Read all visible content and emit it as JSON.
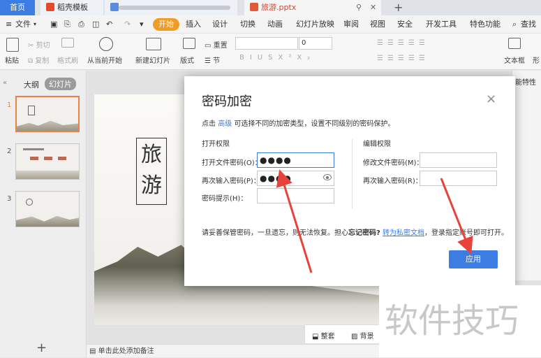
{
  "tabs": {
    "home": "首页",
    "template": "稻壳模板",
    "doc": "旅游.pptx",
    "new_tab": "+"
  },
  "menu": {
    "file": "文件",
    "items": [
      "开始",
      "插入",
      "设计",
      "切换",
      "动画",
      "幻灯片放映",
      "审阅",
      "视图",
      "安全",
      "开发工具",
      "特色功能"
    ],
    "search": "查找"
  },
  "ribbon": {
    "paste": "粘贴",
    "cut": "剪切",
    "copy": "复制",
    "format_painter": "格式刷",
    "play_from_current": "从当前开始",
    "new_slide": "新建幻灯片",
    "layout": "版式",
    "reset": "重置",
    "section": "节",
    "font_size": "0",
    "textbox": "文本框",
    "shape": "形"
  },
  "left_panel": {
    "tab_outline": "大纲",
    "tab_slides": "幻灯片",
    "slide_numbers": [
      "1",
      "2",
      "3"
    ],
    "add_slide": "+"
  },
  "slide": {
    "title_chars": [
      "旅",
      "游"
    ]
  },
  "right_panel": {
    "label": "能特性"
  },
  "dialog": {
    "title": "密码加密",
    "close": "×",
    "desc_prefix": "点击",
    "desc_link": "高级",
    "desc_suffix": "可选择不同的加密类型，设置不同级别的密码保护。",
    "open_section": "打开权限",
    "open_password_label": "打开文件密码(O)：",
    "open_password_value": "●●●●",
    "confirm_password_label": "再次输入密码(P)：",
    "confirm_password_value": "●●●●",
    "hint_label": "密码提示(H)：",
    "hint_value": "",
    "edit_section": "编辑权限",
    "edit_password_label": "修改文件密码(M)：",
    "edit_password_value": "",
    "edit_confirm_label": "再次输入密码(R)：",
    "edit_confirm_value": "",
    "warning_prefix": "请妥善保管密码，一旦遗忘，则无法恢复。担心",
    "warning_bold": "忘记密码?",
    "warning_link": "转为私密文档",
    "warning_suffix": "，登录指定账号即可打开。",
    "apply_button": "应用"
  },
  "bottom": {
    "tidy": "整套",
    "background": "背景",
    "notes_placeholder": "单击此处添加备注"
  },
  "watermark": "软件技巧",
  "colors": {
    "accent_blue": "#3c7de4",
    "active_orange": "#f29b26",
    "arrow_red": "#e8423a"
  }
}
